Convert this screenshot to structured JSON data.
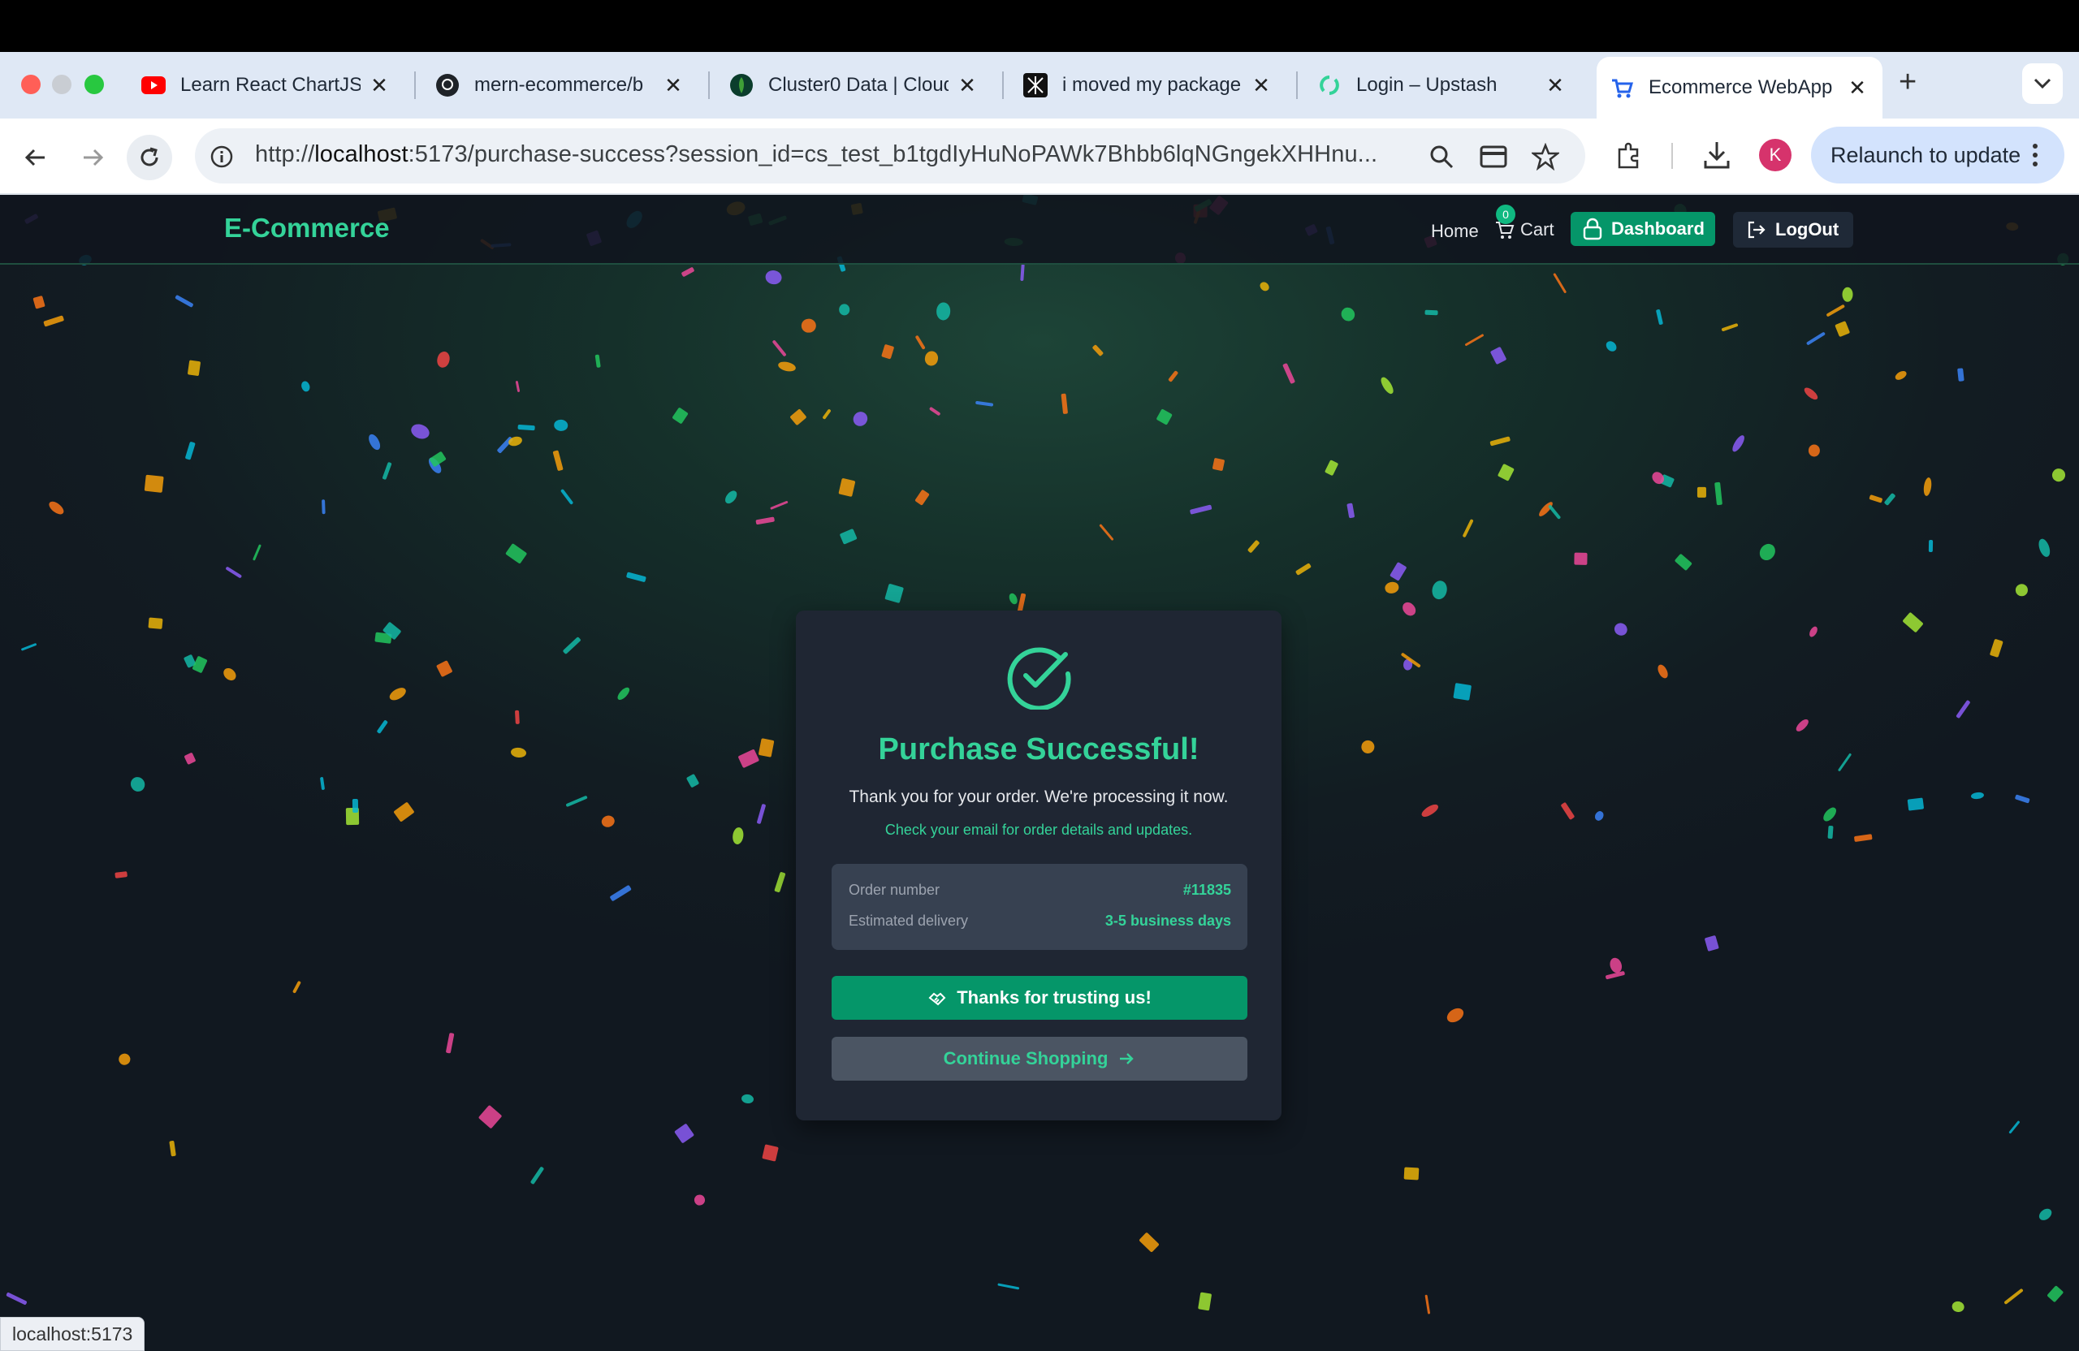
{
  "browser": {
    "tabs": [
      {
        "title": "Learn React ChartJS",
        "icon": "youtube-icon"
      },
      {
        "title": "mern-ecommerce/b",
        "icon": "github-icon"
      },
      {
        "title": "Cluster0 Data | Cloud",
        "icon": "mongodb-icon"
      },
      {
        "title": "i moved my package",
        "icon": "site-icon"
      },
      {
        "title": "Login – Upstash",
        "icon": "upstash-icon"
      },
      {
        "title": "Ecommerce WebApp",
        "icon": "cart-icon"
      }
    ],
    "url_prefix": "http://",
    "url_host": "localhost",
    "url_rest": ":5173/purchase-success?session_id=cs_test_b1tgdIyHuNoPAWk7Bhbb6lqNGngekXHHnu...",
    "profile_initial": "K",
    "relaunch_label": "Relaunch to update",
    "status_text": "localhost:5173"
  },
  "app": {
    "brand": "E-Commerce",
    "nav": {
      "home": "Home",
      "cart": "Cart",
      "cart_count": "0",
      "dashboard": "Dashboard",
      "logout": "LogOut"
    }
  },
  "card": {
    "title": "Purchase Successful!",
    "thanks": "Thank you for your order. We're processing it now.",
    "check_email": "Check your email for order details and updates.",
    "order_label": "Order number",
    "order_value": "#11835",
    "delivery_label": "Estimated delivery",
    "delivery_value": "3-5 business days",
    "thanks_button": "Thanks for trusting us!",
    "continue_button": "Continue Shopping"
  },
  "colors": {
    "accent": "#34d399",
    "button_green": "#059669",
    "card_bg": "#1f2633"
  }
}
